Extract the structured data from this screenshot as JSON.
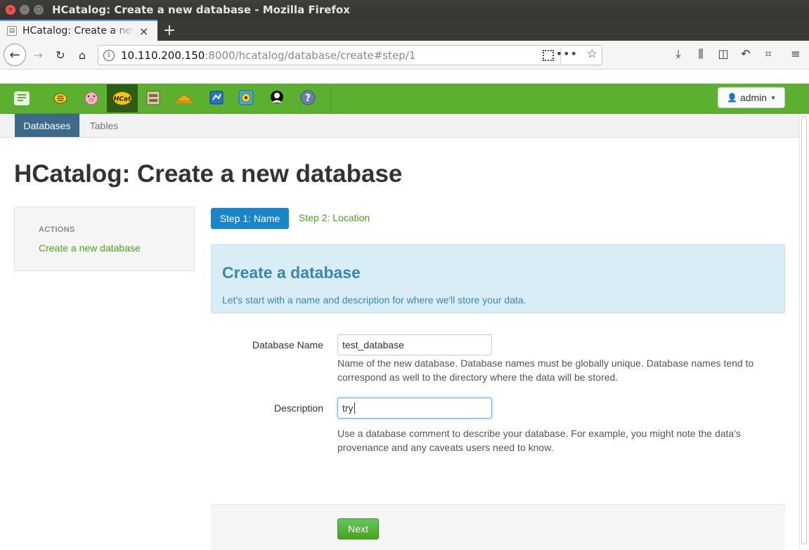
{
  "window": {
    "title": "HCatalog: Create a new database - Mozilla Firefox"
  },
  "browser": {
    "tab_label": "HCatalog: Create a new database",
    "tab_close": "×",
    "new_tab": "+",
    "url_host": "10.110.200.150",
    "url_rest": ":8000/hcatalog/database/create#step/1"
  },
  "app": {
    "user_label": "admin",
    "subnav": [
      "Databases",
      "Tables"
    ],
    "active_subnav": "Databases"
  },
  "page": {
    "title": "HCatalog: Create a new database",
    "sidebar": {
      "heading": "ACTIONS",
      "link": "Create a new database"
    },
    "steps": [
      "Step 1: Name",
      "Step 2: Location"
    ],
    "info": {
      "title": "Create a database",
      "text": "Let's start with a name and description for where we'll store your data."
    },
    "form": {
      "name_label": "Database Name",
      "name_value": "test_database",
      "name_help": "Name of the new database. Database names must be globally unique. Database names tend to correspond as well to the directory where the data will be stored.",
      "desc_label": "Description",
      "desc_value": "try",
      "desc_help": "Use a database comment to describe your database. For example, you might note the data's provenance and any caveats users need to know."
    },
    "next_label": "Next"
  },
  "colors": {
    "hue_green": "#5bb12f",
    "active_tab": "#3d6a8b",
    "step_blue": "#1a85c8",
    "link_green": "#4aa31c",
    "info_text": "#3a87ad"
  }
}
